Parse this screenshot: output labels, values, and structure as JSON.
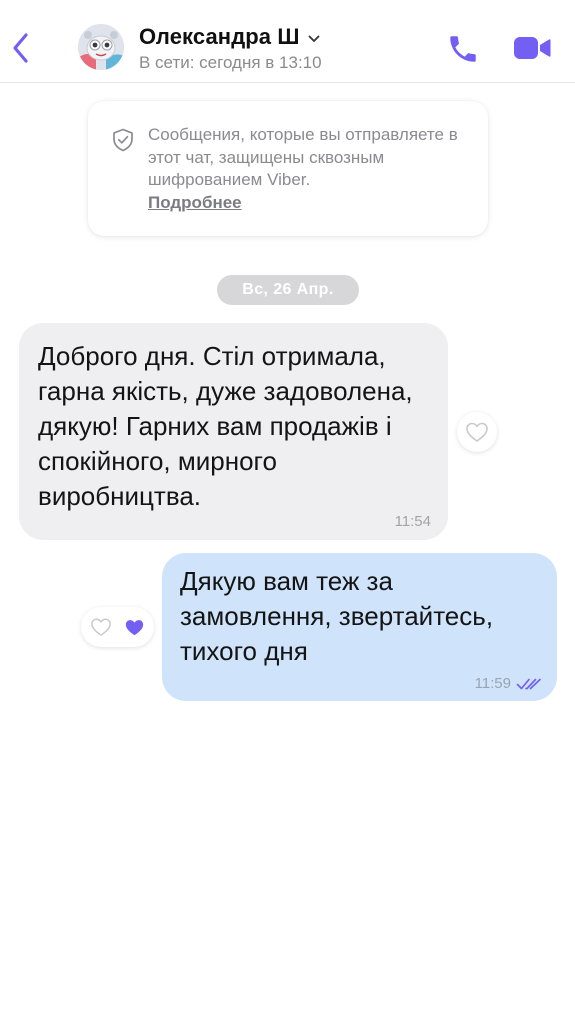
{
  "colors": {
    "accent": "#7360f2",
    "incoming_bubble": "#efeff1",
    "outgoing_bubble": "#cfe4fb",
    "date_chip": "#d7d7da",
    "muted_text": "#8a8a91"
  },
  "header": {
    "back_icon": "chevron-left-icon",
    "contact_name": "Олександра Ш",
    "status": "В сети: сегодня в 13:10",
    "call_icon": "phone-icon",
    "video_icon": "video-camera-icon"
  },
  "notice": {
    "icon": "shield-check-icon",
    "text": "Сообщения, которые вы отправляете в этот чат, защищены сквозным шифрованием Viber.",
    "link": "Подробнее"
  },
  "date_separator": "Вс, 26 Апр.",
  "messages": [
    {
      "direction": "incoming",
      "text": "Доброго дня. Стіл отримала, гарна якість, дуже задоволена, дякую! Гарних вам продажів і спокійного, мирного виробництва.",
      "time": "11:54",
      "reaction": "heart-outline-icon"
    },
    {
      "direction": "outgoing",
      "text": "Дякую вам теж за замовлення, звертайтесь, тихого дня",
      "time": "11:59",
      "status_icon": "double-check-icon",
      "reactions": [
        "heart-outline-icon",
        "heart-filled-icon"
      ]
    }
  ]
}
